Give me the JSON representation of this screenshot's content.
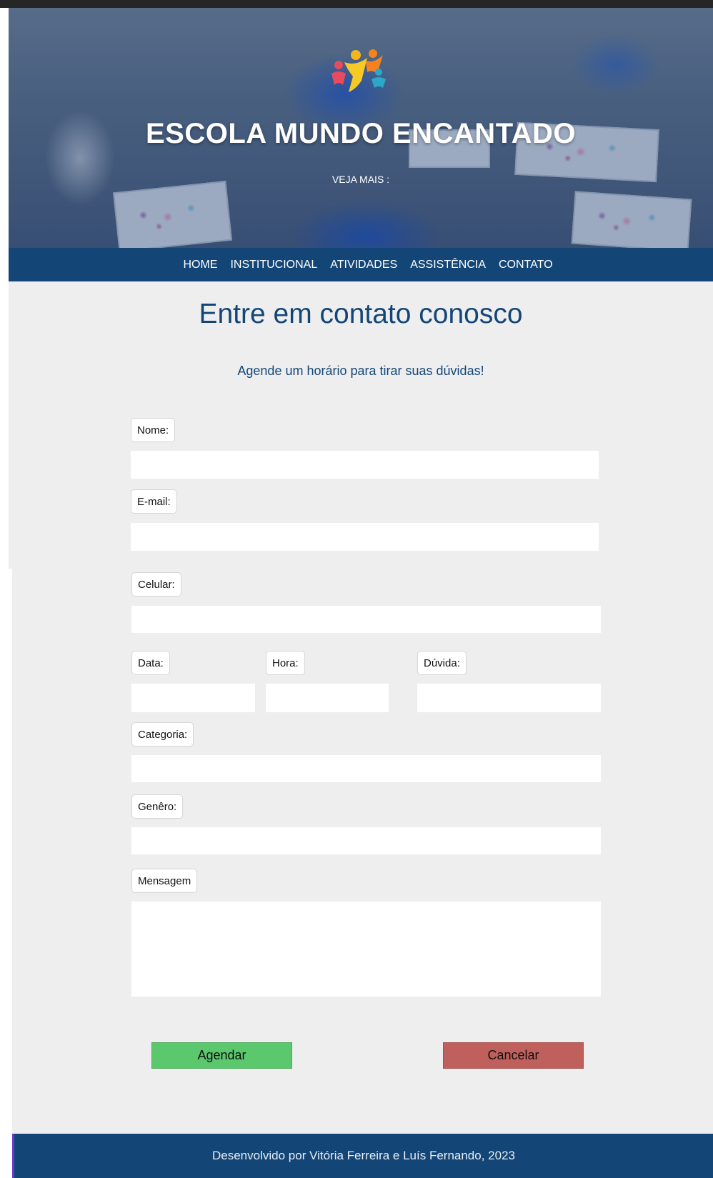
{
  "hero": {
    "title": "ESCOLA MUNDO ENCANTADO",
    "link": "VEJA MAIS :",
    "logo_icon": "children-logo-icon"
  },
  "nav": {
    "items": [
      {
        "label": "HOME"
      },
      {
        "label": "INSTITUCIONAL"
      },
      {
        "label": "ATIVIDADES"
      },
      {
        "label": "ASSISTÊNCIA"
      },
      {
        "label": "CONTATO"
      }
    ]
  },
  "form": {
    "heading": "Entre em contato conosco",
    "subheading": "Agende um horário para tirar suas dúvidas!",
    "labels": {
      "nome": "Nome:",
      "email": "E-mail:",
      "celular": "Celular:",
      "data": "Data:",
      "hora": "Hora:",
      "duvida": "Dúvida:",
      "categoria": "Categoria:",
      "genero": "Genêro:",
      "mensagem": "Mensagem"
    },
    "buttons": {
      "submit": "Agendar",
      "cancel": "Cancelar"
    }
  },
  "footer": {
    "text": "Desenvolvido por Vitória Ferreira e Luís Fernando, 2023"
  },
  "colors": {
    "primary": "#134677",
    "background": "#eeeeee",
    "submit": "#5bc86d",
    "cancel": "#c0605c"
  }
}
